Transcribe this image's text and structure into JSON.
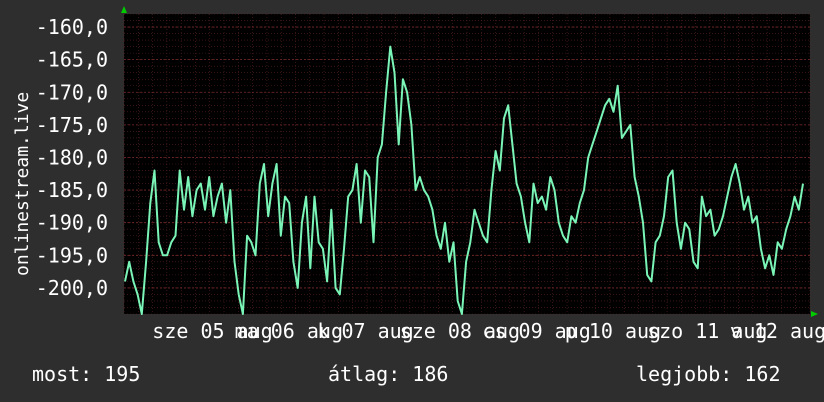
{
  "colors": {
    "background": "#2e2e2e",
    "plot_background": "#000000",
    "line": "#7af5b7",
    "minor_grid": "#5a2222",
    "major_grid": "#7a2a2a",
    "axis_arrow": "#00cc00",
    "text": "#ffffff"
  },
  "stats": {
    "current": "most: 195",
    "average": "átlag: 186",
    "best": "legjobb: 162"
  },
  "chart_data": {
    "type": "line",
    "ylabel": "onlinestream.live",
    "ylim": [
      -204,
      -158
    ],
    "yticks": [
      "-160,0",
      "-165,0",
      "-170,0",
      "-175,0",
      "-180,0",
      "-185,0",
      "-190,0",
      "-195,0",
      "-200,0"
    ],
    "ytick_values": [
      -160,
      -165,
      -170,
      -175,
      -180,
      -185,
      -190,
      -195,
      -200
    ],
    "xlabels": [
      "sze 05 aug",
      "ma 06 aug",
      "k 07 aug",
      "sze 08 aug",
      "cs 09 aug",
      "p 10 aug",
      "szo 11 aug",
      "v 12 aug"
    ],
    "xlim": [
      0,
      160
    ],
    "xlabel_positions": [
      6.6,
      25.8,
      45.1,
      64.3,
      83.6,
      102.8,
      122.0,
      141.3
    ],
    "series": [
      {
        "values": [
          -199,
          -196,
          -199,
          -201,
          -204,
          -196,
          -187,
          -182,
          -193,
          -195,
          -195,
          -193,
          -192,
          -182,
          -188,
          -183,
          -189,
          -185,
          -184,
          -188,
          -183,
          -189,
          -186,
          -184,
          -190,
          -185,
          -196,
          -201,
          -204,
          -192,
          -193,
          -195,
          -184,
          -181,
          -189,
          -184,
          -181,
          -192,
          -186,
          -187,
          -196,
          -200,
          -190,
          -186,
          -197,
          -186,
          -193,
          -194,
          -199,
          -188,
          -200,
          -201,
          -194,
          -186,
          -185,
          -181,
          -190,
          -182,
          -183,
          -193,
          -180,
          -178,
          -170,
          -163,
          -167,
          -178,
          -168,
          -170,
          -175,
          -185,
          -183,
          -185,
          -186,
          -188,
          -192,
          -194,
          -190,
          -196,
          -193,
          -202,
          -204,
          -196,
          -193,
          -188,
          -190,
          -192,
          -193,
          -185,
          -179,
          -182,
          -174,
          -172,
          -178,
          -184,
          -186,
          -190,
          -193,
          -184,
          -187,
          -186,
          -188,
          -183,
          -185,
          -190,
          -192,
          -193,
          -189,
          -190,
          -187,
          -185,
          -180,
          -178,
          -176,
          -174,
          -172,
          -171,
          -173,
          -169,
          -177,
          -176,
          -175,
          -183,
          -186,
          -190,
          -198,
          -199,
          -193,
          -192,
          -189,
          -183,
          -182,
          -190,
          -194,
          -190,
          -191,
          -196,
          -197,
          -186,
          -189,
          -188,
          -192,
          -191,
          -189,
          -186,
          -183,
          -181,
          -184,
          -188,
          -186,
          -190,
          -189,
          -194,
          -197,
          -195,
          -198,
          -193,
          -194,
          -191,
          -189,
          -186,
          -188,
          -184
        ]
      }
    ]
  }
}
